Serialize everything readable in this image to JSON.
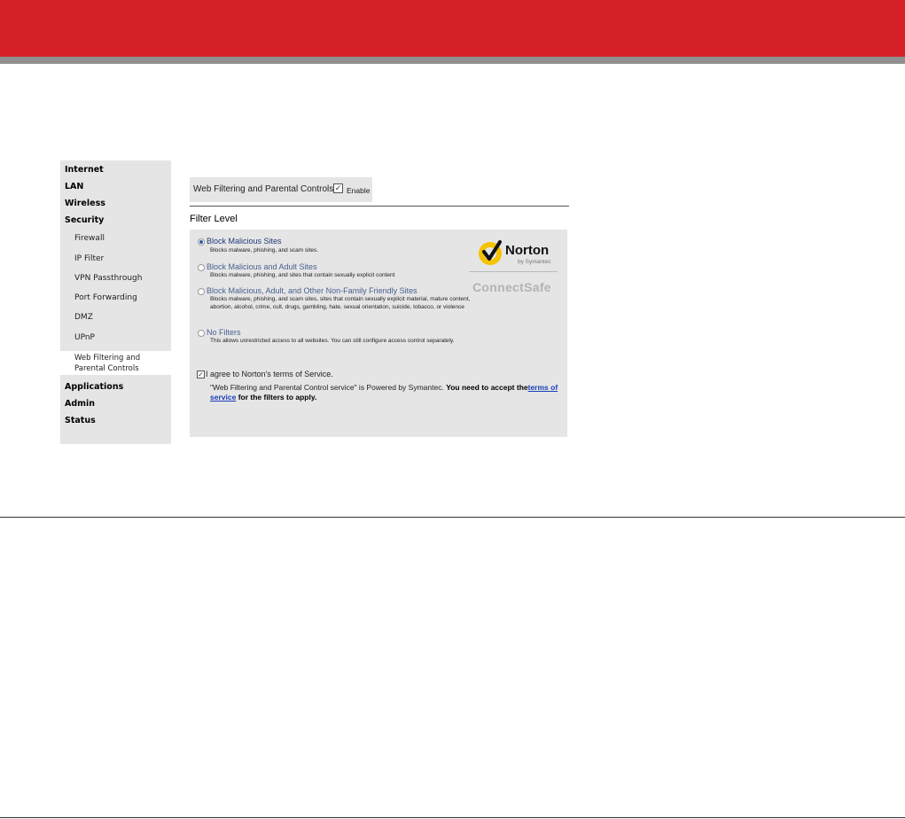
{
  "sidebar": {
    "items": [
      {
        "label": "Internet"
      },
      {
        "label": "LAN"
      },
      {
        "label": "Wireless"
      },
      {
        "label": "Security"
      },
      {
        "label": "Firewall"
      },
      {
        "label": "IP Filter"
      },
      {
        "label": "VPN Passthrough"
      },
      {
        "label": "Port Forwarding"
      },
      {
        "label": "DMZ"
      },
      {
        "label": "UPnP"
      },
      {
        "label": "Web Filtering and Parental Controls"
      },
      {
        "label": "Applications"
      },
      {
        "label": "Admin"
      },
      {
        "label": "Status"
      }
    ]
  },
  "header": {
    "title": "Web Filtering and Parental Controls",
    "enable_label": "Enable",
    "enable_checked": true
  },
  "filter": {
    "heading": "Filter Level",
    "selected": "Block Malicious Sites",
    "options": [
      {
        "title": "Block Malicious Sites",
        "desc": "Blocks malware, phishing, and scam sites."
      },
      {
        "title": "Block Malicious and Adult Sites",
        "desc": "Blocks malware, phishing, and sites that contain sexually explicit content"
      },
      {
        "title": "Block Malicious, Adult, and Other Non-Family Friendly Sites",
        "desc": "Blocks malware, phishing, and scam sites, sites that contain sexually explicit material, mature content, abortion, alcohol, crime, cult, drugs, gambling, hate, sexual orientation, suicide, tobacco, or violence"
      },
      {
        "title": "No Filters",
        "desc": "This allows unrestricted access to all websites. You can still configure access control separately."
      }
    ]
  },
  "brand": {
    "norton": "Norton",
    "by": "by Symantec",
    "connectsafe": "ConnectSafe"
  },
  "agreement": {
    "checked": true,
    "label": "I agree to Norton's terms of Service.",
    "desc_quote": "\"Web Filtering and Parental Control service\" is Powered by Symantec.",
    "desc_bold": "You need to accept the",
    "link": "terms of service",
    "desc_tail": "for the filters to apply."
  },
  "colors": {
    "header_red": "#d62028",
    "stripe_gray": "#8f8f8f",
    "panel_gray": "#e5e5e5",
    "link_blue": "#1a3db8",
    "norton_yellow": "#f6c300"
  },
  "icons": [
    "norton-check-logo",
    "checkbox-checked",
    "radio-selected",
    "radio-unselected"
  ]
}
